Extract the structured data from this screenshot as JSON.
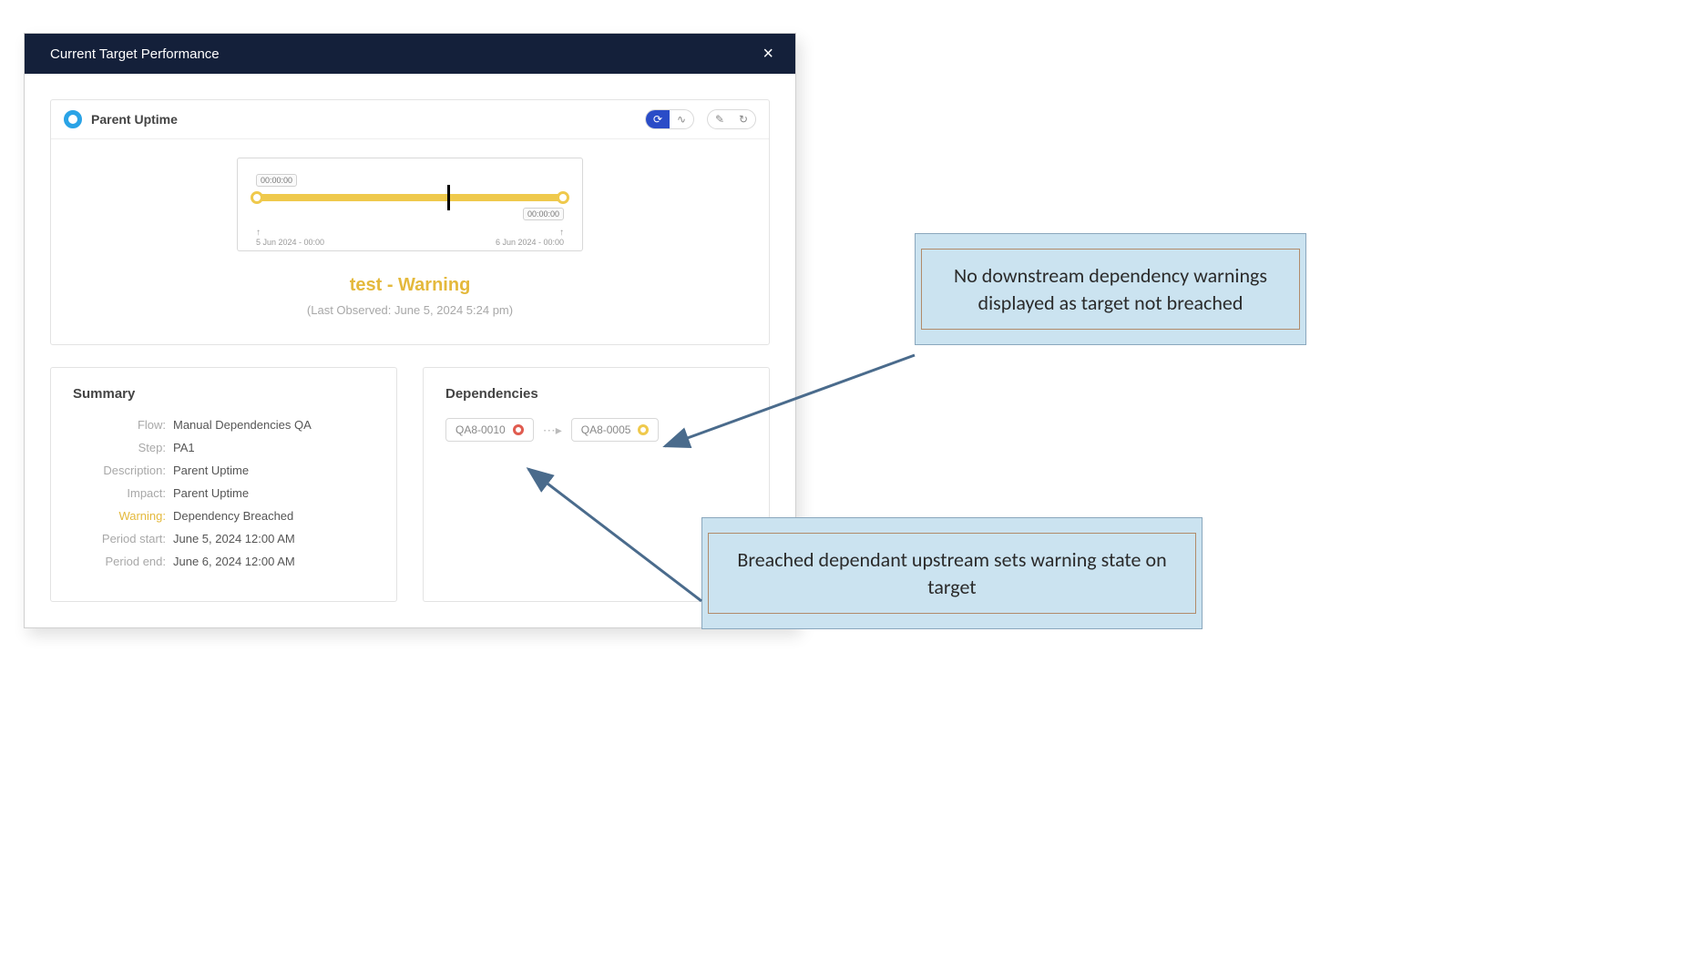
{
  "modal": {
    "title": "Current Target Performance",
    "close_glyph": "×"
  },
  "uptime": {
    "title": "Parent Uptime",
    "dot_action": "⟳",
    "wave_action": "∿",
    "pin_action": "✎",
    "refresh_action": "↻",
    "timeline": {
      "start_badge": "00:00:00",
      "end_badge": "00:00:00",
      "axis_start": "5 Jun 2024 - 00:00",
      "axis_end": "6 Jun 2024 - 00:00"
    },
    "status_text": "test - Warning",
    "observed_text": "(Last Observed: June 5, 2024 5:24 pm)"
  },
  "summary": {
    "title": "Summary",
    "rows": [
      {
        "k": "Flow:",
        "v": "Manual Dependencies QA"
      },
      {
        "k": "Step:",
        "v": "PA1"
      },
      {
        "k": "Description:",
        "v": "Parent Uptime"
      },
      {
        "k": "Impact:",
        "v": "Parent Uptime"
      },
      {
        "k": "Warning:",
        "v": "Dependency Breached",
        "warn": true
      },
      {
        "k": "Period start:",
        "v": "June 5, 2024 12:00 AM"
      },
      {
        "k": "Period end:",
        "v": "June 6, 2024 12:00 AM"
      }
    ]
  },
  "deps": {
    "title": "Dependencies",
    "chip_a": "QA8-0010",
    "chip_b": "QA8-0005",
    "arrow": "⋯▸"
  },
  "callouts": {
    "c1": "No downstream dependency warnings displayed as target not breached",
    "c2": "Breached dependant upstream sets warning state on target"
  }
}
